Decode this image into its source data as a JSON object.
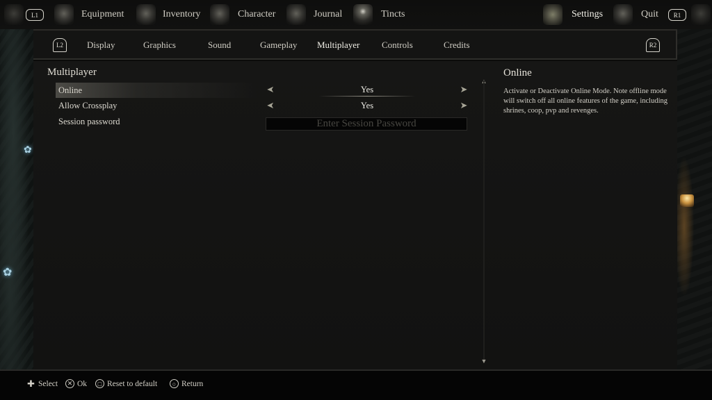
{
  "topnav": {
    "left_bumper": "L1",
    "right_bumper": "R1",
    "items": [
      {
        "label": "Equipment",
        "icon": "equipment-icon"
      },
      {
        "label": "Inventory",
        "icon": "inventory-icon"
      },
      {
        "label": "Character",
        "icon": "character-icon"
      },
      {
        "label": "Journal",
        "icon": "journal-icon"
      },
      {
        "label": "Tincts",
        "icon": "tincts-icon"
      },
      {
        "label": "Settings",
        "icon": "settings-icon",
        "active": true
      },
      {
        "label": "Quit",
        "icon": "quit-door-icon"
      }
    ]
  },
  "subnav": {
    "left_trigger": "L2",
    "right_trigger": "R2",
    "tabs": [
      "Display",
      "Graphics",
      "Sound",
      "Gameplay",
      "Multiplayer",
      "Controls",
      "Credits"
    ],
    "active_tab": "Multiplayer"
  },
  "settings": {
    "section_title": "Multiplayer",
    "rows": [
      {
        "label": "Online",
        "value": "Yes",
        "selected": true
      },
      {
        "label": "Allow Crossplay",
        "value": "Yes"
      },
      {
        "label": "Session password",
        "placeholder": "Enter Session Password",
        "value": ""
      }
    ]
  },
  "info": {
    "title": "Online",
    "description": "Activate or Deactivate Online Mode. Note offline mode will switch off all online features of the game, including shrines, coop, pvp and revenges."
  },
  "hints": [
    {
      "icon": "dpad-icon",
      "label": "Select"
    },
    {
      "icon": "cross-button-icon",
      "label": "Ok"
    },
    {
      "icon": "square-button-icon",
      "label": "Reset to default"
    },
    {
      "icon": "circle-button-icon",
      "label": "Return"
    }
  ]
}
